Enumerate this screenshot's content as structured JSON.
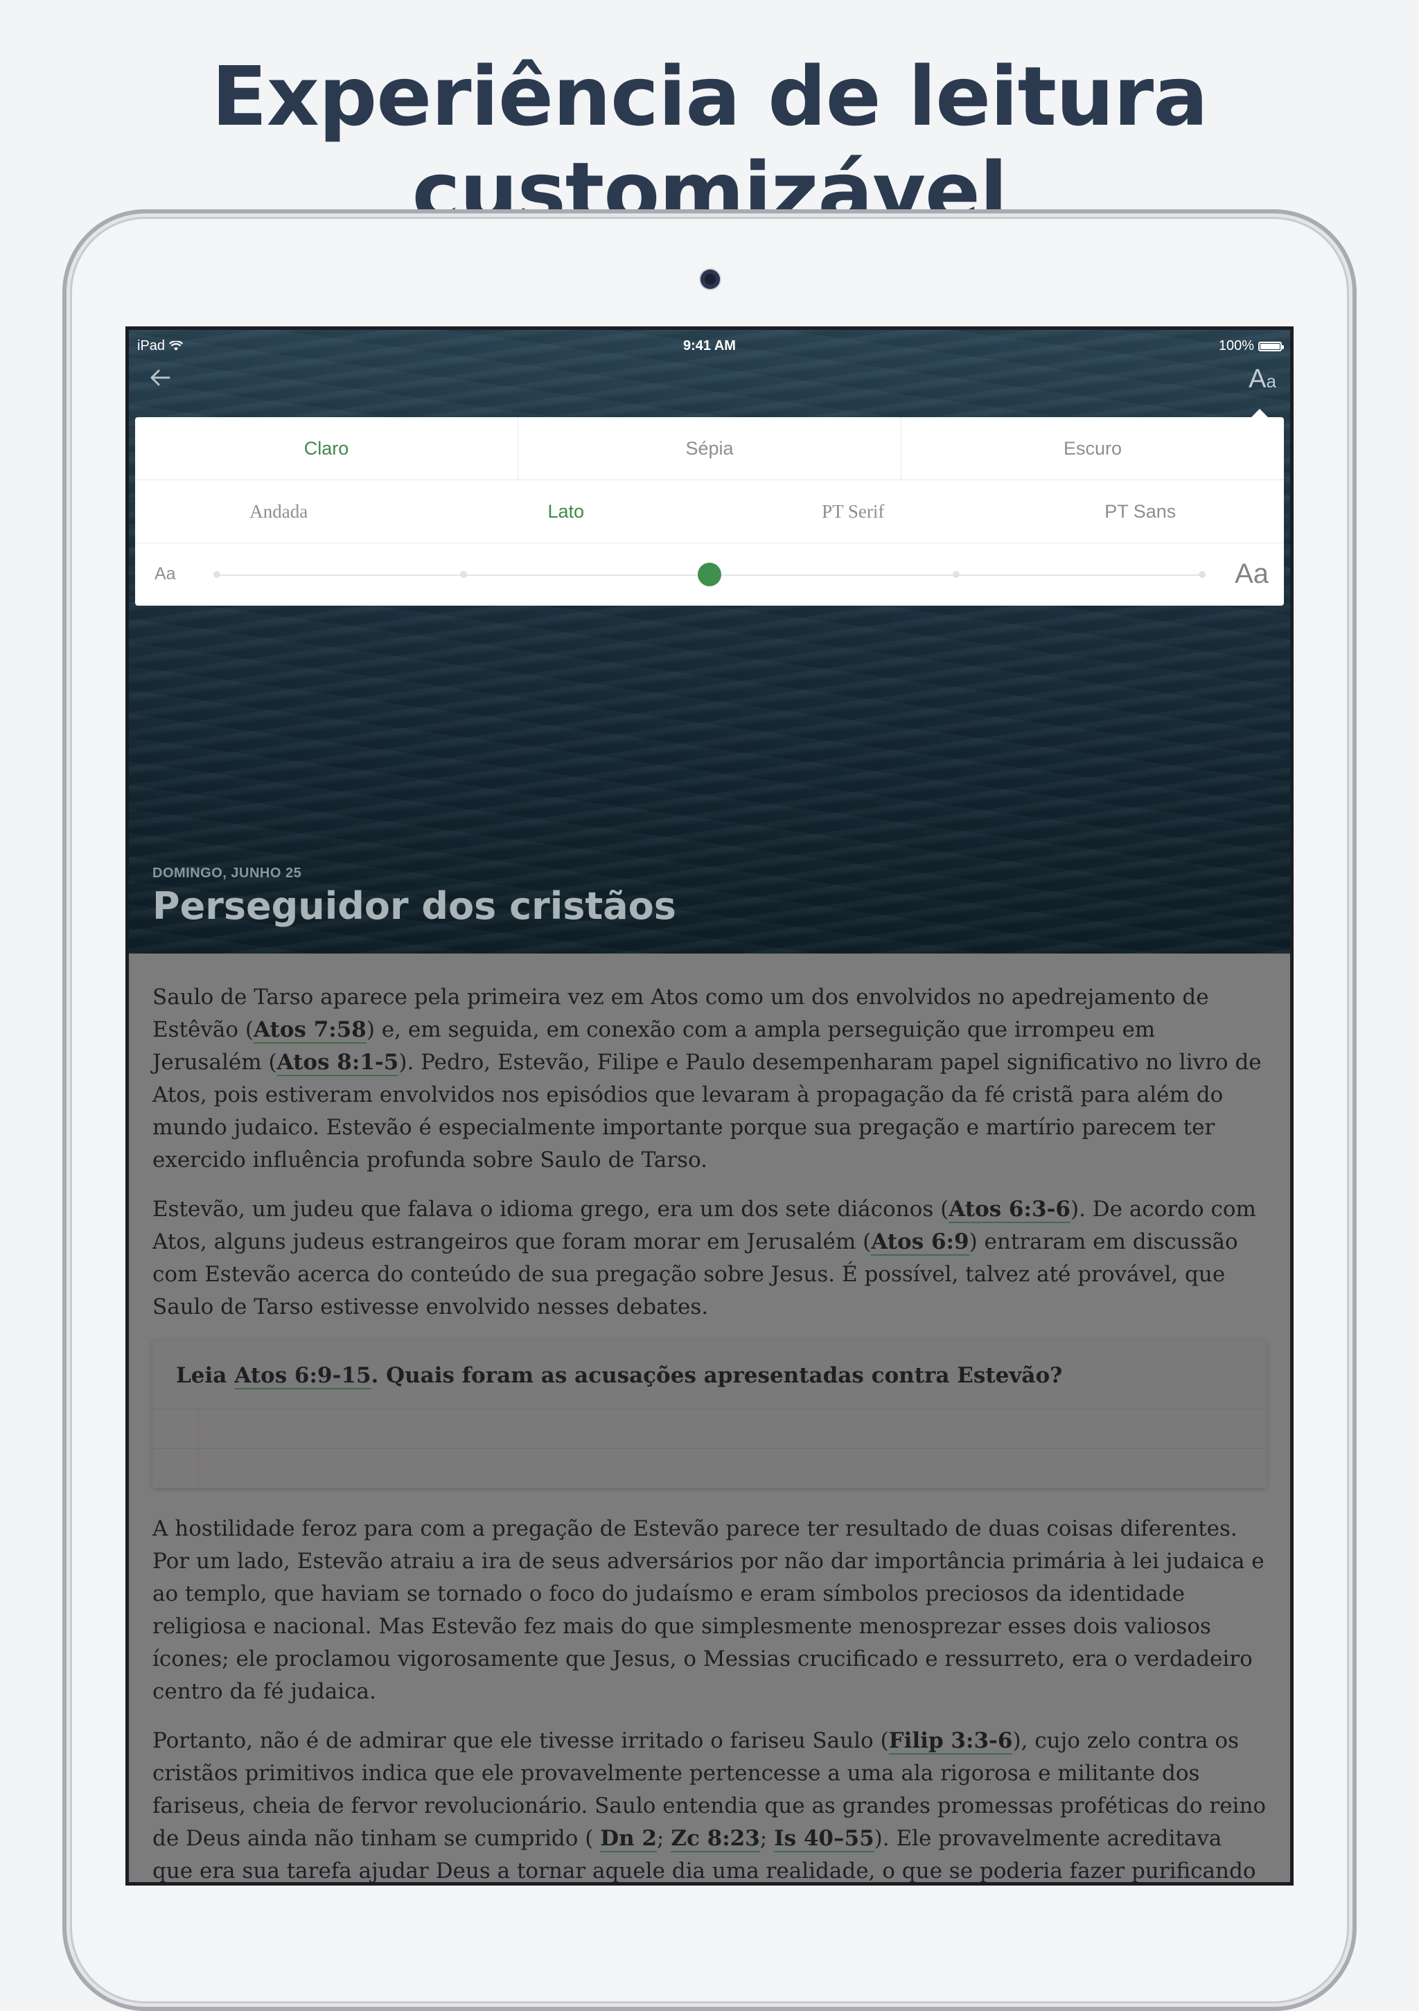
{
  "headline": "Experiência de leitura customizável",
  "status_bar": {
    "device": "iPad",
    "time": "9:41 AM",
    "battery": "100%"
  },
  "toolbar": {
    "back_icon": "arrow-left-icon",
    "text_settings_label_large": "A",
    "text_settings_label_small": "a"
  },
  "settings": {
    "themes": [
      "Claro",
      "Sépia",
      "Escuro"
    ],
    "active_theme": "Claro",
    "fonts": [
      "Andada",
      "Lato",
      "PT Serif",
      "PT Sans"
    ],
    "active_font": "Lato",
    "size_small_label": "Aa",
    "size_large_label": "Aa",
    "size_steps": 5,
    "size_selected_index": 2,
    "accent_color": "#3f8f4d"
  },
  "lesson": {
    "date": "DOMINGO, JUNHO 25",
    "title": "Perseguidor dos cristãos"
  },
  "article": {
    "p1": {
      "t1": "Saulo de Tarso aparece pela primeira vez em Atos como um dos envolvidos no apedrejamento de Estêvão (",
      "r1": "Atos 7:58",
      "t2": ") e, em seguida, em conexão com a ampla perseguição que irrompeu em Jerusalém (",
      "r2": "Atos 8:1-5",
      "t3": "). Pedro, Estevão, Filipe e Paulo desempenharam papel significativo no livro de Atos, pois estiveram envolvidos nos episódios que levaram à propagação da fé cristã para além do mundo judaico. Estevão é especialmente importante porque sua pregação e martírio parecem ter exercido influência profunda sobre Saulo de Tarso."
    },
    "p2": {
      "t1": "Estevão, um judeu que falava o idioma grego, era um dos sete diáconos (",
      "r1": "Atos 6:3-6",
      "t2": "). De acordo com Atos, alguns judeus estrangeiros que foram morar em Jerusalém (",
      "r2": "Atos 6:9",
      "t3": ") entraram em discussão com Estevão acerca do conteúdo de sua pregação sobre Jesus. É possível, talvez até provável, que Saulo de Tarso estivesse envolvido nesses debates."
    },
    "question": {
      "t1": "Leia ",
      "r1": "Atos 6:9-15",
      "t2": ". Quais foram as acusações apresentadas contra Estevão?"
    },
    "p3": "A hostilidade feroz para com a pregação de Estevão parece ter resultado de duas coisas diferentes. Por um lado, Estevão atraiu a ira de seus adversários por não dar importância primária à lei judaica e ao templo, que haviam se tornado o foco do judaísmo e eram símbolos preciosos da identidade religiosa e nacional. Mas Estevão fez mais do que simplesmente menosprezar esses dois valiosos ícones; ele proclamou vigorosamente que Jesus, o Messias crucificado e ressurreto, era o verdadeiro centro da fé judaica.",
    "p4": {
      "t1": "Portanto, não é de admirar que ele tivesse irritado o fariseu Saulo (",
      "r1": "Filip 3:3-6",
      "t2": "), cujo zelo contra os cristãos primitivos indica que ele provavelmente pertencesse a uma ala rigorosa e militante dos fariseus, cheia de fervor revolucionário. Saulo entendia que as grandes promessas proféticas do reino de Deus ainda não tinham se cumprido ( ",
      "r2": "Dn 2",
      "s1": "; ",
      "r3": "Zc 8:23",
      "s2": "; ",
      "r4": "Is 40–55",
      "t3": "). Ele provavelmente acreditava que era sua tarefa ajudar Deus a tornar aquele dia uma realidade, o que se poderia fazer purificando Israel da corrupção religiosa e da ideia de que esse Jesus era o Messias."
    }
  }
}
